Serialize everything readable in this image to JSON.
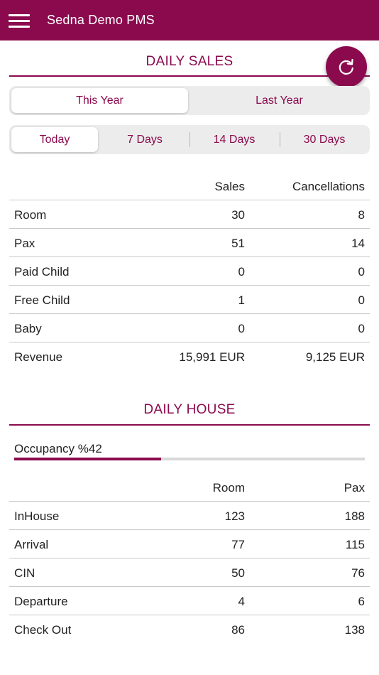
{
  "app": {
    "title": "Sedna Demo PMS"
  },
  "colors": {
    "primary": "#8b0a4e",
    "segment_bg": "#ececec",
    "divider": "#c8c8c8"
  },
  "icons": {
    "menu": "hamburger-menu-icon",
    "refresh": "refresh-icon"
  },
  "daily_sales": {
    "title": "DAILY SALES",
    "year_tabs": [
      {
        "label": "This Year",
        "active": true
      },
      {
        "label": "Last Year",
        "active": false
      }
    ],
    "period_tabs": [
      {
        "label": "Today",
        "active": true
      },
      {
        "label": "7 Days",
        "active": false
      },
      {
        "label": "14 Days",
        "active": false
      },
      {
        "label": "30 Days",
        "active": false
      }
    ],
    "columns": [
      "",
      "Sales",
      "Cancellations"
    ],
    "rows": [
      {
        "label": "Room",
        "sales": "30",
        "cancellations": "8"
      },
      {
        "label": "Pax",
        "sales": "51",
        "cancellations": "14"
      },
      {
        "label": "Paid Child",
        "sales": "0",
        "cancellations": "0"
      },
      {
        "label": "Free Child",
        "sales": "1",
        "cancellations": "0"
      },
      {
        "label": "Baby",
        "sales": "0",
        "cancellations": "0"
      },
      {
        "label": "Revenue",
        "sales": "15,991 EUR",
        "cancellations": "9,125 EUR"
      }
    ]
  },
  "daily_house": {
    "title": "DAILY HOUSE",
    "occupancy_label": "Occupancy %42",
    "occupancy_percent": 42,
    "columns": [
      "",
      "Room",
      "Pax"
    ],
    "rows": [
      {
        "label": "InHouse",
        "room": "123",
        "pax": "188"
      },
      {
        "label": "Arrival",
        "room": "77",
        "pax": "115"
      },
      {
        "label": "CIN",
        "room": "50",
        "pax": "76"
      },
      {
        "label": "Departure",
        "room": "4",
        "pax": "6"
      },
      {
        "label": "Check Out",
        "room": "86",
        "pax": "138"
      }
    ]
  }
}
